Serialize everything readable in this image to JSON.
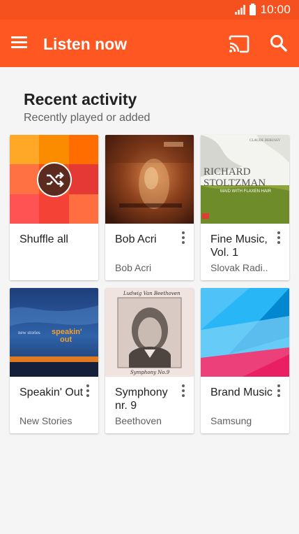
{
  "status_bar": {
    "time": "10:00"
  },
  "app_bar": {
    "title": "Listen now"
  },
  "section": {
    "title": "Recent activity",
    "subtitle": "Recently played or added"
  },
  "cards": [
    {
      "title": "Shuffle all",
      "subtitle": ""
    },
    {
      "title": "Bob Acri",
      "subtitle": "Bob Acri"
    },
    {
      "title": "Fine Music, Vol. 1",
      "subtitle": "Slovak Radi.."
    },
    {
      "title": "Speakin' Out",
      "subtitle": "New Stories"
    },
    {
      "title": "Symphony nr. 9",
      "subtitle": "Beethoven"
    },
    {
      "title": "Brand Music",
      "subtitle": "Samsung"
    }
  ],
  "album_art_text": {
    "stoltzman": {
      "top": "CLAUDE DEBUSSY",
      "line1": "RICHARD",
      "line2": "STOLTZMAN",
      "line3": "MAID WITH FLAXEN HAIR"
    },
    "speakin": {
      "line1": "new stories",
      "line2": "speakin'",
      "line3": "out"
    },
    "beethoven": {
      "top": "Ludwig Van Beethoven",
      "bottom": "Symphony No.9"
    }
  },
  "colors": {
    "status_bar": "#f4511e",
    "app_bar": "#ff5722",
    "background": "#f5f5f5"
  },
  "icons": [
    "menu-icon",
    "cast-icon",
    "search-icon",
    "signal-icon",
    "battery-icon",
    "shuffle-icon",
    "more-vert-icon"
  ]
}
